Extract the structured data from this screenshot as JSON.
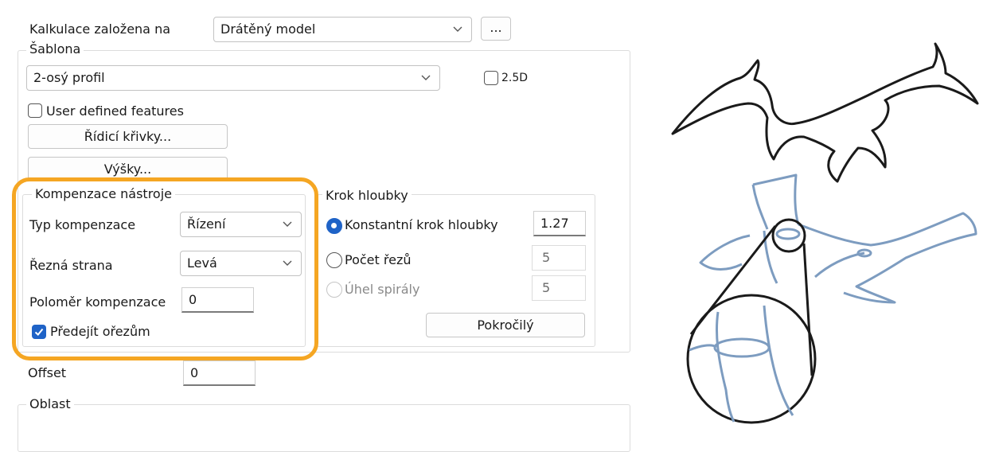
{
  "calc": {
    "label": "Kalkulace založena na",
    "value": "Drátěný model",
    "more_button": "..."
  },
  "template": {
    "legend": "Šablona",
    "value": "2-osý profil",
    "checkbox_25d": {
      "label": "2.5D",
      "checked": false
    },
    "user_defined": {
      "label": "User defined features",
      "checked": false
    },
    "drive_curves_button": "Řídicí křivky...",
    "heights_button": "Výšky..."
  },
  "compensation": {
    "legend": "Kompenzace nástroje",
    "type_label": "Typ kompenzace",
    "type_value": "Řízení",
    "side_label": "Řezná strana",
    "side_value": "Levá",
    "radius_label": "Poloměr kompenzace",
    "radius_value": "0",
    "avoid_label": "Předejít ořezům",
    "avoid_checked": true
  },
  "depth": {
    "legend": "Krok hloubky",
    "constant_label": "Konstantní krok hloubky",
    "constant_value": "1.27",
    "count_label": "Počet řezů",
    "count_value": "5",
    "spiral_label": "Úhel spirály",
    "spiral_value": "5",
    "advanced_button": "Pokročilý",
    "selected": "constant"
  },
  "offset": {
    "label": "Offset",
    "value": "0"
  },
  "area": {
    "legend": "Oblast"
  },
  "colors": {
    "accent": "#1f63c7",
    "highlight": "#f5a623",
    "sketch_blue": "#7d9cc0",
    "sketch_black": "#1a1a1a"
  },
  "icons": [
    "chevron-down-icon",
    "checkbox-icon",
    "radio-icon",
    "wireframe-preview-illustration"
  ]
}
